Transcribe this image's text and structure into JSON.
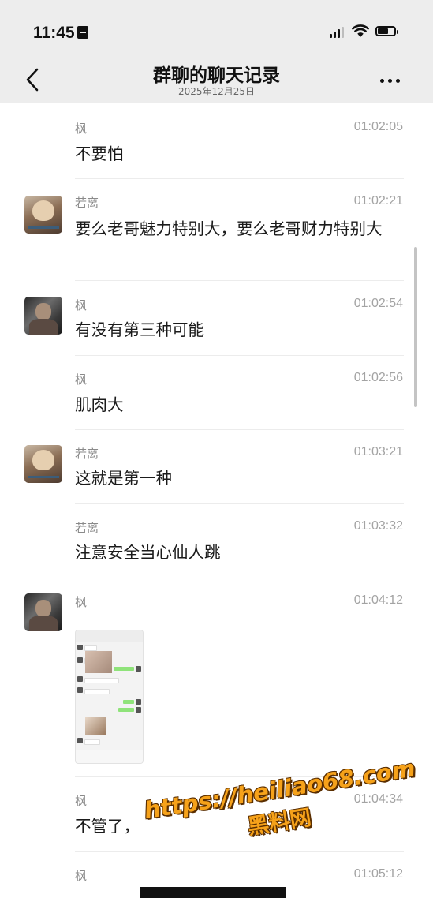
{
  "status_bar": {
    "time": "11:45",
    "icons": [
      "sim-icon",
      "signal-icon",
      "wifi-icon",
      "battery-icon"
    ]
  },
  "nav": {
    "back_icon": "chevron-left-icon",
    "title": "群聊的聊天记录",
    "date": "2025年12月25日",
    "more_icon": "more-dots-icon"
  },
  "messages": [
    {
      "name": "枫",
      "time": "01:02:05",
      "text": "不要怕",
      "avatar": ""
    },
    {
      "name": "若离",
      "time": "01:02:21",
      "text": "要么老哥魅力特别大，要么老哥财力特别大",
      "avatar": "ruoli"
    },
    {
      "name": "枫",
      "time": "01:02:54",
      "text": "有没有第三种可能",
      "avatar": "feng"
    },
    {
      "name": "枫",
      "time": "01:02:56",
      "text": "肌肉大",
      "avatar": ""
    },
    {
      "name": "若离",
      "time": "01:03:21",
      "text": "这就是第一种",
      "avatar": "ruoli"
    },
    {
      "name": "若离",
      "time": "01:03:32",
      "text": "注意安全当心仙人跳",
      "avatar": ""
    },
    {
      "name": "枫",
      "time": "01:04:12",
      "text": "",
      "avatar": "feng",
      "image": "chat-screenshot-thumbnail"
    },
    {
      "name": "枫",
      "time": "01:04:34",
      "text": "不管了，",
      "avatar": ""
    },
    {
      "name": "枫",
      "time": "01:05:12",
      "text": "",
      "avatar": ""
    }
  ],
  "watermark": {
    "url": "https://heiliao68.com",
    "text": "黑料网"
  },
  "colors": {
    "header_bg": "#ededed",
    "watermark": "#f6a21a",
    "timestamp": "#a3a3a3",
    "name": "#8a8a8a"
  }
}
